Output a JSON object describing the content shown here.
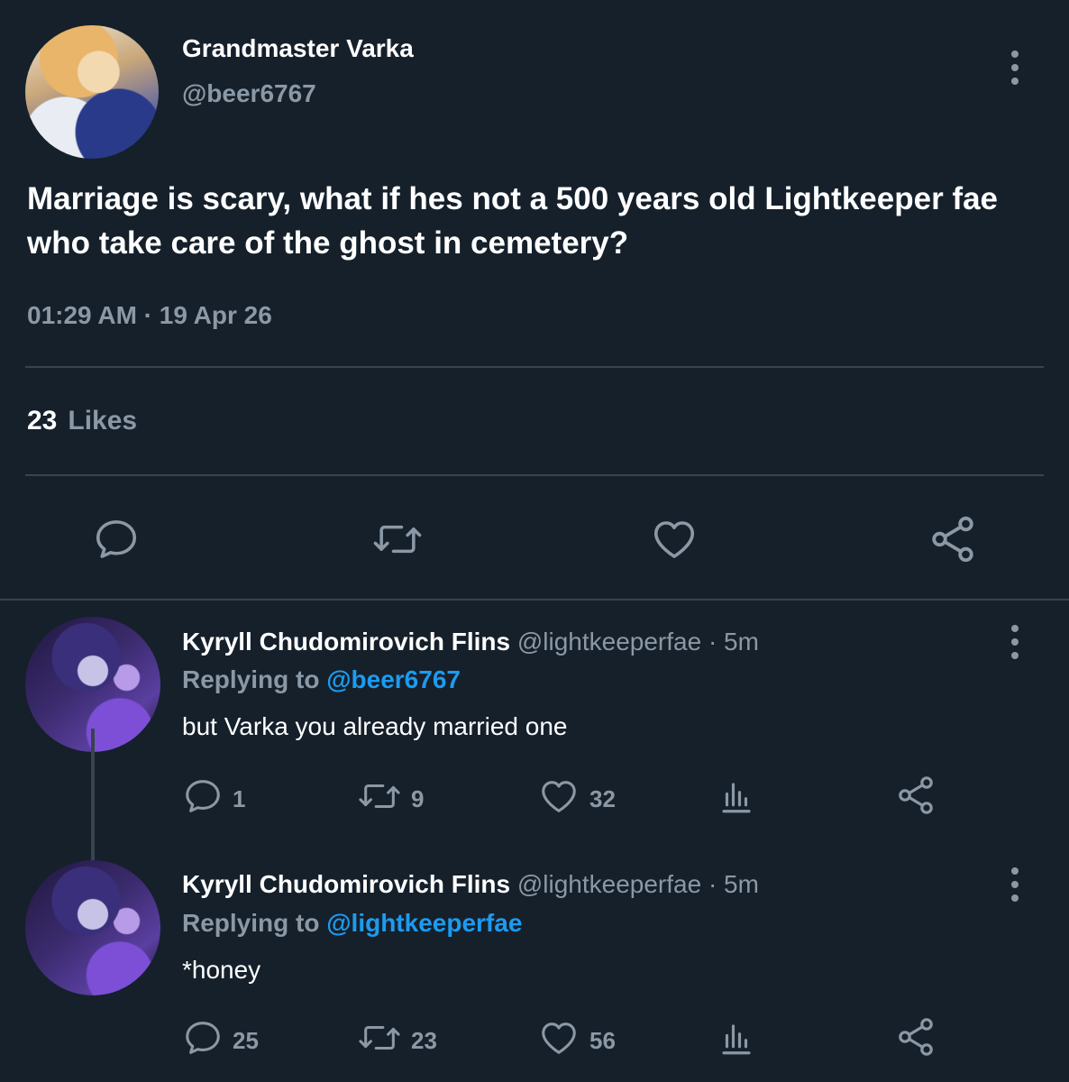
{
  "main_tweet": {
    "display_name": "Grandmaster Varka",
    "handle": "@beer6767",
    "text": "Marriage is scary, what if hes not a 500 years old Lightkeeper fae who take care of the ghost in cemetery?",
    "timestamp": "01:29 AM · 19 Apr 26",
    "likes_count": "23",
    "likes_label": "Likes",
    "actions": [
      "reply-icon",
      "retweet-icon",
      "like-icon",
      "share-icon"
    ]
  },
  "replies": [
    {
      "display_name": "Kyryll Chudomirovich Flins",
      "meta": "@lightkeeperfae · 5m",
      "replying_prefix": "Replying to",
      "replying_to": "@beer6767",
      "text": "but Varka you already married one",
      "reply_count": "1",
      "retweet_count": "9",
      "like_count": "32"
    },
    {
      "display_name": "Kyryll Chudomirovich Flins",
      "meta": "@lightkeeperfae · 5m",
      "replying_prefix": "Replying to",
      "replying_to": "@lightkeeperfae",
      "text": "*honey",
      "reply_count": "25",
      "retweet_count": "23",
      "like_count": "56"
    }
  ],
  "colors": {
    "background": "#15202b",
    "text_primary": "#ffffff",
    "text_secondary": "#8b98a5",
    "accent": "#1d9bf0",
    "divider": "#38444d"
  }
}
